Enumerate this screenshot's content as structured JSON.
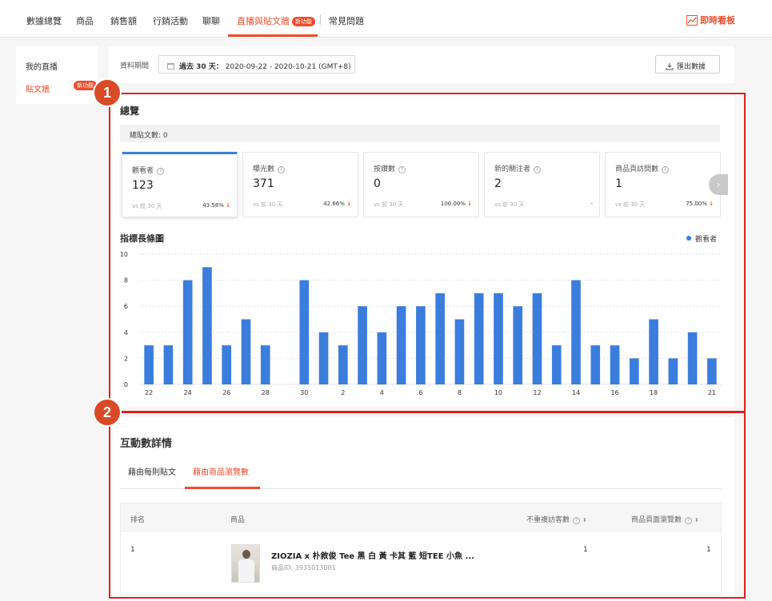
{
  "topnav": {
    "tabs": [
      "數據總覽",
      "商品",
      "銷售額",
      "行銷活動",
      "聊聊",
      "直播與貼文牆",
      "常見問題"
    ],
    "active_tab": "直播與貼文牆",
    "new_badge": "新功能",
    "realtime_label": "即時看板"
  },
  "sidebar": {
    "items": [
      "我的直播",
      "貼文牆"
    ],
    "active_item": "貼文牆",
    "badge": "新功能"
  },
  "period": {
    "label": "資料期間",
    "range_bold": "過去 30 天：",
    "range": "2020-09-22 - 2020-10-21 (GMT+8)",
    "export_label": "匯出數據"
  },
  "overview": {
    "title": "總覽",
    "total_posts": "總貼文數: 0",
    "kpis": [
      {
        "label": "觀看者",
        "value": "123",
        "vs": "vs 前 30 天",
        "change": "43.58%",
        "arrow": "↓"
      },
      {
        "label": "曝光數",
        "value": "371",
        "vs": "vs 前 30 天",
        "change": "42.66%",
        "arrow": "↓"
      },
      {
        "label": "按讚數",
        "value": "0",
        "vs": "vs 前 30 天",
        "change": "100.00%",
        "arrow": "↓"
      },
      {
        "label": "新的關注者",
        "value": "2",
        "vs": "vs 前 30 天",
        "change": "-",
        "arrow": ""
      },
      {
        "label": "商品頁訪問數",
        "value": "1",
        "vs": "vs 前 30 天",
        "change": "75.00%",
        "arrow": "↓"
      }
    ],
    "chart_title": "指標長條圖",
    "legend": "觀看者"
  },
  "chart_data": {
    "type": "bar",
    "title": "指標長條圖",
    "xlabel": "",
    "ylabel": "",
    "ylim": [
      0,
      10
    ],
    "yticks": [
      0,
      2,
      4,
      6,
      8,
      10
    ],
    "grid": true,
    "legend_position": "top-right",
    "color": "#3b7ddd",
    "categories": [
      "22",
      "23",
      "24",
      "25",
      "26",
      "27",
      "28",
      "29",
      "30",
      "1",
      "2",
      "3",
      "4",
      "5",
      "6",
      "7",
      "8",
      "9",
      "10",
      "11",
      "12",
      "13",
      "14",
      "15",
      "16",
      "17",
      "18",
      "19",
      "20",
      "21"
    ],
    "tick_labels": [
      "22",
      "24",
      "26",
      "28",
      "30",
      "2",
      "4",
      "6",
      "8",
      "10",
      "12",
      "14",
      "16",
      "18",
      "21"
    ],
    "series": [
      {
        "name": "觀看者",
        "values": [
          3,
          3,
          8,
          9,
          3,
          5,
          3,
          0,
          8,
          4,
          3,
          6,
          4,
          6,
          6,
          7,
          5,
          7,
          7,
          6,
          7,
          3,
          8,
          3,
          3,
          2,
          5,
          2,
          4,
          2
        ]
      }
    ]
  },
  "details": {
    "title": "互動數詳情",
    "tabs": [
      "藉由每則貼文",
      "藉由商品瀏覽數"
    ],
    "active_tab": "藉由商品瀏覽數",
    "columns": [
      "排名",
      "商品",
      "不重複訪客數",
      "商品頁面瀏覽數"
    ],
    "rows": [
      {
        "rank": "1",
        "product": "ZIOZIA x 朴敘俊 Tee 黑 白 黃 卡其 藍 短TEE 小魚 ...",
        "product_id": "商品ID: 3935013001",
        "unique_visitors": "1",
        "page_views": "1"
      }
    ]
  },
  "annotations": [
    "1",
    "2"
  ]
}
